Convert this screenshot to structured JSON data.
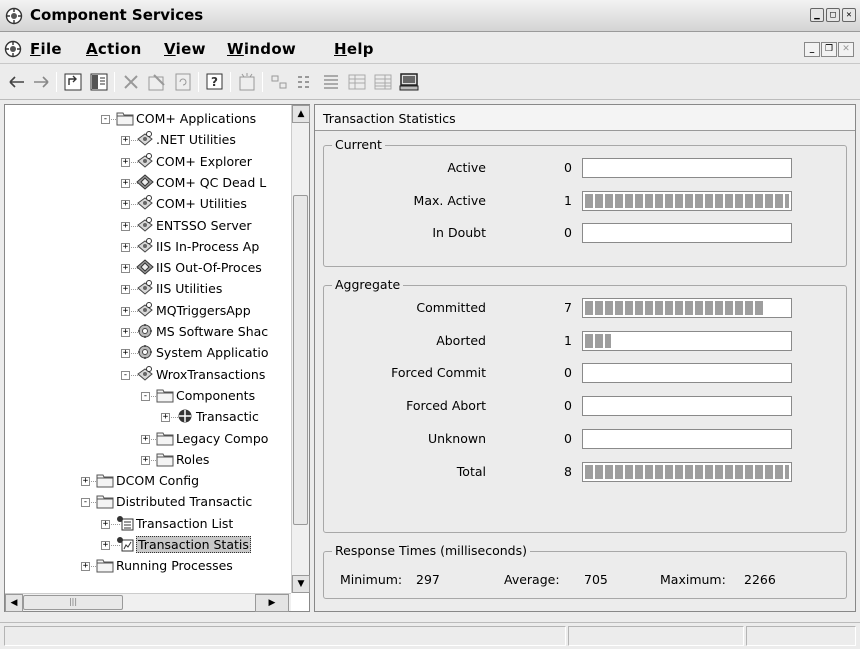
{
  "window": {
    "title": "Component Services",
    "icon": "component-services-icon"
  },
  "menu": [
    {
      "label": "File",
      "accel": "F",
      "rest": "ile"
    },
    {
      "label": "Action",
      "accel": "A",
      "rest": "ction"
    },
    {
      "label": "View",
      "accel": "V",
      "rest": "iew"
    },
    {
      "label": "Window",
      "accel": "W",
      "rest": "indow"
    },
    {
      "label": "Help",
      "accel": "H",
      "rest": "elp"
    }
  ],
  "toolbar": {
    "icons": [
      "back-arrow-icon",
      "forward-arrow-icon",
      "up-one-level-icon",
      "show-hide-console-tree-icon",
      "delete-icon",
      "properties-icon",
      "refresh-icon",
      "help-icon",
      "new-object-icon",
      "large-icons-view-icon",
      "small-icons-view-icon",
      "list-view-icon",
      "detail-view-icon",
      "status-view-icon",
      "computer-icon"
    ]
  },
  "tree": {
    "items": [
      {
        "label": "COM+ Applications",
        "icon": "folder-icon",
        "expander": "−",
        "level": 0
      },
      {
        "label": ".NET Utilities",
        "icon": "com-app-icon",
        "expander": "+",
        "level": 1
      },
      {
        "label": "COM+ Explorer",
        "icon": "com-app-icon",
        "expander": "+",
        "level": 1
      },
      {
        "label": "COM+ QC Dead L",
        "icon": "com-queued-app-icon",
        "expander": "+",
        "level": 1
      },
      {
        "label": "COM+ Utilities",
        "icon": "com-app-icon",
        "expander": "+",
        "level": 1
      },
      {
        "label": "ENTSSO Server",
        "icon": "com-app-icon",
        "expander": "+",
        "level": 1
      },
      {
        "label": "IIS In-Process Ap",
        "icon": "com-app-icon",
        "expander": "+",
        "level": 1
      },
      {
        "label": "IIS Out-Of-Proces",
        "icon": "com-queued-app-icon",
        "expander": "+",
        "level": 1
      },
      {
        "label": "IIS Utilities",
        "icon": "com-app-icon",
        "expander": "+",
        "level": 1
      },
      {
        "label": "MQTriggersApp",
        "icon": "com-app-icon",
        "expander": "+",
        "level": 1
      },
      {
        "label": "MS Software Shac",
        "icon": "com-system-app-icon",
        "expander": "+",
        "level": 1
      },
      {
        "label": "System Applicatio",
        "icon": "com-system-app-icon",
        "expander": "+",
        "level": 1
      },
      {
        "label": "WroxTransactions",
        "icon": "com-app-icon",
        "expander": "−",
        "level": 1
      },
      {
        "label": "Components",
        "icon": "folder-icon",
        "expander": "−",
        "level": 2
      },
      {
        "label": "Transactic",
        "icon": "component-icon",
        "expander": "+",
        "level": 3
      },
      {
        "label": "Legacy Compo",
        "icon": "folder-icon",
        "expander": "+",
        "level": 2
      },
      {
        "label": "Roles",
        "icon": "folder-icon",
        "expander": "+",
        "level": 2
      },
      {
        "label": "DCOM Config",
        "icon": "folder-icon",
        "expander": "+",
        "level": -1
      },
      {
        "label": "Distributed Transactic",
        "icon": "folder-icon",
        "expander": "−",
        "level": -1
      },
      {
        "label": "Transaction List",
        "icon": "transaction-list-icon",
        "expander": "+",
        "level": 0
      },
      {
        "label": "Transaction Statis",
        "icon": "transaction-statistics-icon",
        "expander": "+",
        "level": 0,
        "selected": true
      },
      {
        "label": "Running Processes",
        "icon": "folder-icon",
        "expander": "+",
        "level": -1
      }
    ]
  },
  "detail": {
    "title": "Transaction Statistics",
    "current": {
      "legend": "Current",
      "rows": [
        {
          "label": "Active",
          "value": "0",
          "fill": 0
        },
        {
          "label": "Max. Active",
          "value": "1",
          "fill": 1.0
        },
        {
          "label": "In Doubt",
          "value": "0",
          "fill": 0
        }
      ]
    },
    "aggregate": {
      "legend": "Aggregate",
      "rows": [
        {
          "label": "Committed",
          "value": "7",
          "fill": 0.875
        },
        {
          "label": "Aborted",
          "value": "1",
          "fill": 0.125
        },
        {
          "label": "Forced Commit",
          "value": "0",
          "fill": 0
        },
        {
          "label": "Forced Abort",
          "value": "0",
          "fill": 0
        },
        {
          "label": "Unknown",
          "value": "0",
          "fill": 0
        },
        {
          "label": "Total",
          "value": "8",
          "fill": 1.0
        }
      ]
    },
    "response": {
      "legend": "Response Times (milliseconds)",
      "minimum_label": "Minimum:",
      "minimum": "297",
      "average_label": "Average:",
      "average": "705",
      "maximum_label": "Maximum:",
      "maximum": "2266"
    }
  },
  "colors": {
    "bar_fill": "#9e9e9e",
    "selection": "#c8c8c8"
  }
}
